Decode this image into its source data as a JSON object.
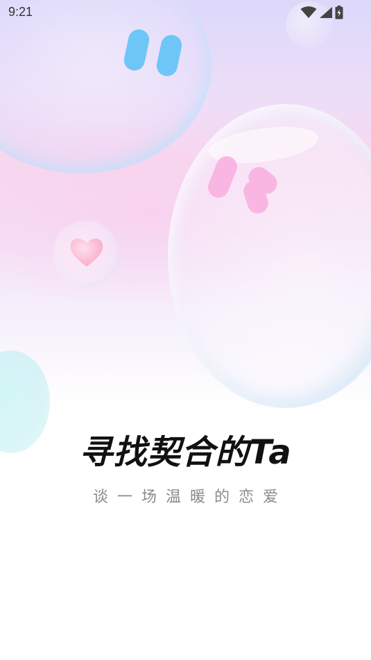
{
  "status_bar": {
    "time": "9:21",
    "icons": [
      "wifi-icon",
      "cellular-signal-icon",
      "battery-charging-icon"
    ]
  },
  "splash": {
    "headline": "寻找契合的Ta",
    "subline": "谈一场温暖的恋爱"
  },
  "decor": {
    "quote_blue_color": "#6ec6f7",
    "quote_pink_color": "#f9b6e2",
    "heart_color": "#f8a9c8"
  }
}
